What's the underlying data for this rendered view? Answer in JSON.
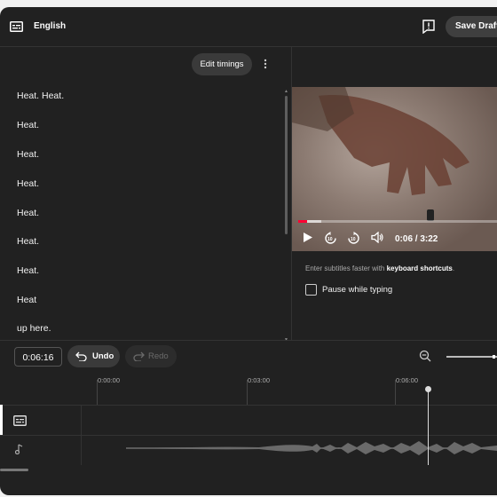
{
  "header": {
    "language": "English",
    "save_label": "Save Draft",
    "icons": [
      "subtitles-icon",
      "feedback-icon"
    ]
  },
  "editor": {
    "edit_timings_label": "Edit timings",
    "lines": [
      "Heat. Heat.",
      "Heat.",
      "Heat.",
      "Heat.",
      "Heat.",
      "Heat.",
      "Heat.",
      "Heat",
      "up here."
    ]
  },
  "player": {
    "time_readout": "0:06 / 3:22",
    "progress_fraction": 0.03,
    "icons": [
      "play-icon",
      "rewind-10-icon",
      "forward-10-icon",
      "volume-icon"
    ]
  },
  "hint": {
    "prefix": "Enter subtitles faster with ",
    "link": "keyboard shortcuts",
    "suffix": "."
  },
  "pause_while_typing": {
    "label": "Pause while typing",
    "checked": false
  },
  "timeline": {
    "current_timecode": "0:06:16",
    "undo_label": "Undo",
    "redo_label": "Redo",
    "ruler_labels": [
      "0:00:00",
      "0:03:00",
      "0:06:00"
    ]
  },
  "colors": {
    "background": "#212121",
    "accent_red": "#ff0033"
  }
}
